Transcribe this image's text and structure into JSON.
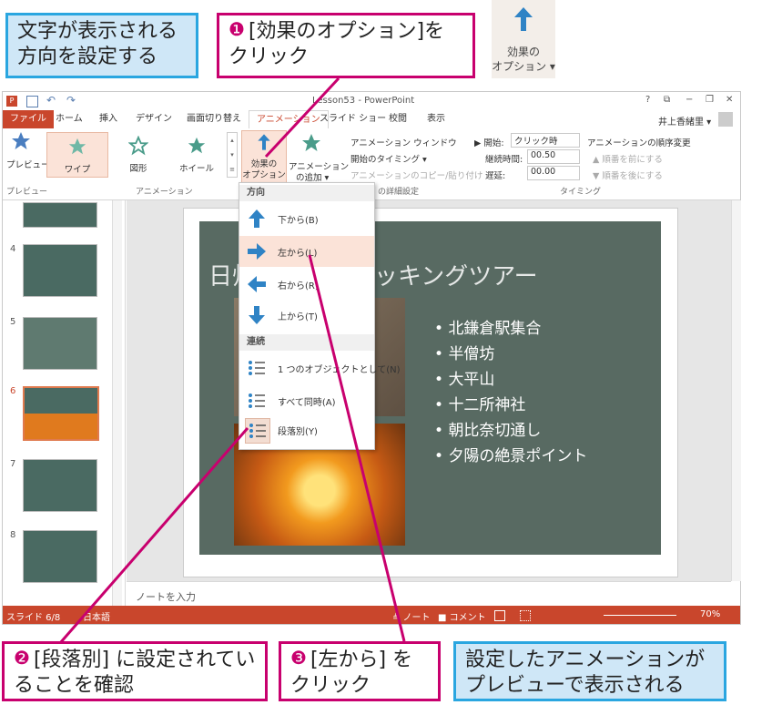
{
  "callouts": {
    "top_left": "文字が表示される方向を設定する",
    "step1_num": "❶",
    "step1": "[効果のオプション]をクリック",
    "step2_num": "❷",
    "step2": "[段落別] に設定されていることを確認",
    "step3_num": "❸",
    "step3": "[左から] をクリック",
    "bottom_right": "設定したアニメーションがプレビューで表示される"
  },
  "effect_button_zoom": {
    "line1": "効果の",
    "line2": "オプション ▾"
  },
  "window": {
    "title": "Lesson53 - PowerPoint",
    "user": "井上香緒里 ▾",
    "title_controls": [
      "?",
      "⧉",
      "−",
      "❐",
      "✕"
    ]
  },
  "tabs": [
    "ファイル",
    "ホーム",
    "挿入",
    "デザイン",
    "画面切り替え",
    "アニメーション",
    "スライド ショー",
    "校閲",
    "表示"
  ],
  "ribbon": {
    "preview": "プレビュー",
    "gallery": [
      "ワイプ",
      "図形",
      "ホイール"
    ],
    "effect_options_1": "効果の",
    "effect_options_2": "オプション ▾",
    "add_animation_1": "アニメーション",
    "add_animation_2": "の追加 ▾",
    "animation_pane": "アニメーション ウィンドウ",
    "trigger": "開始のタイミング ▾",
    "painter": "アニメーションのコピー/貼り付け",
    "start_label": "▶ 開始:",
    "start_value": "クリック時",
    "duration_label": "継続時間:",
    "duration_value": "00.50",
    "delay_label": "遅延:",
    "delay_value": "00.00",
    "reorder_title": "アニメーションの順序変更",
    "move_earlier": "▲ 順番を前にする",
    "move_later": "▼ 順番を後にする",
    "group_preview": "プレビュー",
    "group_animation": "アニメーション",
    "group_advanced": "の詳細設定",
    "group_timing": "タイミング"
  },
  "menu": {
    "header_direction": "方向",
    "directions": [
      "下から(B)",
      "左から(L)",
      "右から(R)",
      "上から(T)"
    ],
    "header_sequence": "連続",
    "sequences": [
      "1 つのオブジェクトとして(N)",
      "すべて同時(A)",
      "段落別(Y)"
    ]
  },
  "thumbnails": [
    "4",
    "5",
    "6",
    "7",
    "8"
  ],
  "slide": {
    "title": "日帰り鎌倉トレッキングツアー",
    "bullets": [
      "北鎌倉駅集合",
      "半僧坊",
      "大平山",
      "十二所神社",
      "朝比奈切通し",
      "夕陽の絶景ポイント"
    ]
  },
  "notes_placeholder": "ノートを入力",
  "status": {
    "slide": "スライド 6/8",
    "lang": "日本語",
    "notes": "≜ ノート",
    "comments": "■ コメント",
    "zoom": "70%"
  },
  "colors": {
    "accent": "#c9462c",
    "pink": "#c8006e",
    "blue": "#2aa6e0",
    "slide_bg": "#586a62"
  }
}
